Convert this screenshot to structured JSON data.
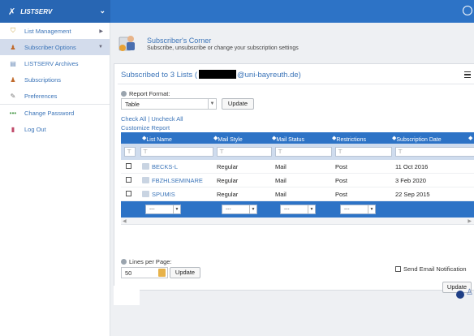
{
  "app": {
    "brand": "LISTSERV"
  },
  "sidebar": {
    "items": [
      {
        "label": "List Management",
        "icon": "list-management-icon"
      },
      {
        "label": "Subscriber Options",
        "icon": "subscriber-options-icon"
      },
      {
        "label": "LISTSERV Archives",
        "icon": "archives-icon"
      },
      {
        "label": "Subscriptions",
        "icon": "subscriptions-icon"
      },
      {
        "label": "Preferences",
        "icon": "preferences-icon"
      },
      {
        "label": "Change Password",
        "icon": "password-icon"
      },
      {
        "label": "Log Out",
        "icon": "logout-icon"
      }
    ]
  },
  "header": {
    "title": "Subscriber's Corner",
    "subtitle": "Subscribe, unsubscribe or change your subscription settings"
  },
  "panel": {
    "title_prefix": "Subscribed to 3 Lists (",
    "title_suffix": "@uni-bayreuth.de)",
    "report_format_label": "Report Format:",
    "report_format_value": "Table",
    "update_label": "Update",
    "check_all": "Check All",
    "uncheck_all": "Uncheck All",
    "link_sep": " | ",
    "customize_report": "Customize Report"
  },
  "grid": {
    "columns": [
      "List Name",
      "Mail Style",
      "Mail Status",
      "Restrictions",
      "Subscription Date"
    ],
    "rows": [
      {
        "list": "BECKS-L",
        "style": "Regular",
        "status": "Mail",
        "restrictions": "Post",
        "date": "11 Oct 2016"
      },
      {
        "list": "FBZHLSEMINARE",
        "style": "Regular",
        "status": "Mail",
        "restrictions": "Post",
        "date": "3 Feb 2020"
      },
      {
        "list": "SPUMIS",
        "style": "Regular",
        "status": "Mail",
        "restrictions": "Post",
        "date": "22 Sep 2015"
      }
    ],
    "footer_select": "---"
  },
  "lines_per_page": {
    "label": "Lines per Page:",
    "value": "50",
    "update_label": "Update"
  },
  "notify": {
    "label": "Send Email Notification"
  },
  "bottom_update": "Update",
  "colors": {
    "accent": "#2d73c6",
    "link": "#3b74b8"
  }
}
